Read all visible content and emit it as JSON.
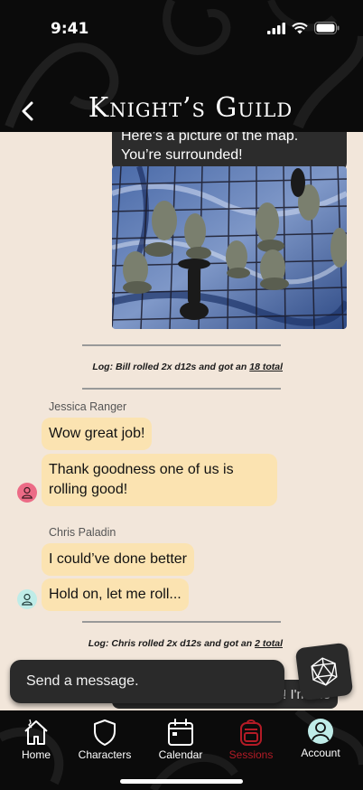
{
  "status": {
    "time": "9:41"
  },
  "header": {
    "title": "Knight’s Guild"
  },
  "messages": {
    "outgoing_text": "Here’s a picture of the map. You’re surrounded!",
    "log1": {
      "prefix": "Log: Bill rolled ",
      "dice": "2x d12s",
      "mid": " and got an ",
      "result": "18 total"
    },
    "jessica": {
      "name": "Jessica Ranger",
      "msg1": "Wow great job!",
      "msg2": "Thank goodness one of us is rolling good!"
    },
    "chris": {
      "name": "Chris Paladin",
      "msg1": "I could’ve done better",
      "msg2": "Hold on, let me roll..."
    },
    "log2": {
      "prefix": "Log: Chris rolled ",
      "dice": "2x d12s",
      "mid": " and got an ",
      "result": "2 total"
    },
    "peek_text": "! I'm the"
  },
  "composer": {
    "placeholder": "Send a message."
  },
  "tabs": [
    {
      "label": "Home"
    },
    {
      "label": "Characters"
    },
    {
      "label": "Calendar"
    },
    {
      "label": "Sessions"
    },
    {
      "label": "Account"
    }
  ],
  "colors": {
    "background": "#f2e6da",
    "bubble_incoming": "#fbe3b1",
    "bubble_outgoing": "#2c2c2c",
    "active_tab": "#b31b26",
    "jessica_avatar": "#ec6b86",
    "chris_avatar": "#bfece8"
  }
}
